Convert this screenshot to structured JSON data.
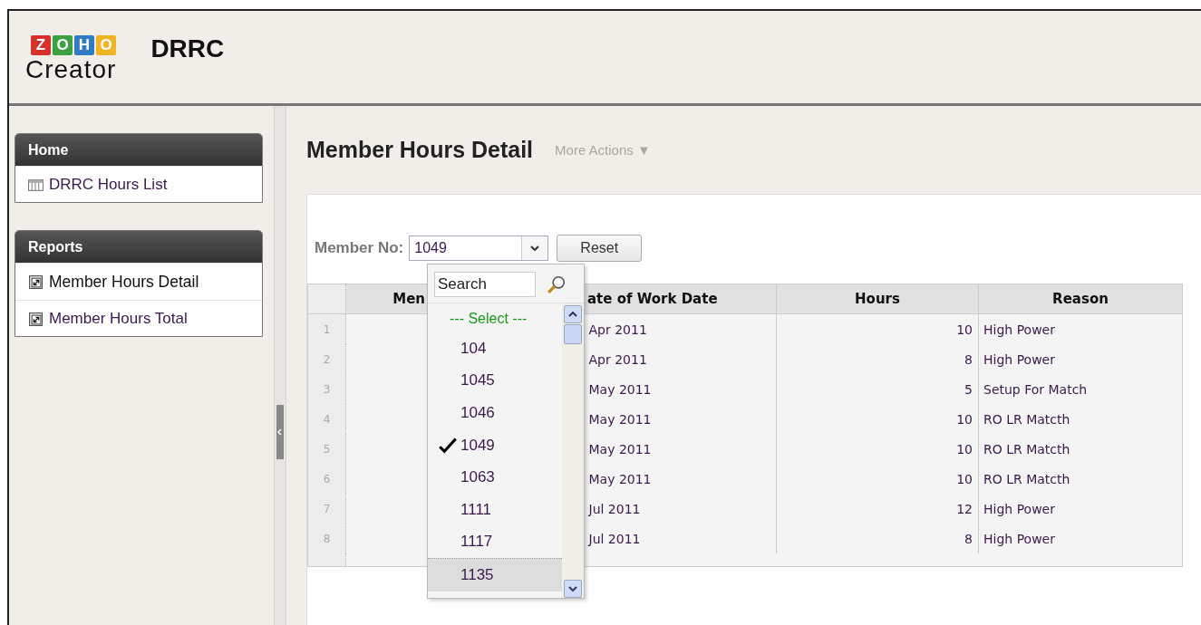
{
  "header": {
    "logo": {
      "letters": [
        {
          "char": "Z",
          "color": "#d8312b"
        },
        {
          "char": "O",
          "color": "#3aa040"
        },
        {
          "char": "H",
          "color": "#2f7bc4"
        },
        {
          "char": "O",
          "color": "#f0b323"
        }
      ],
      "product": "Creator"
    },
    "app_name": "DRRC"
  },
  "sidebar": {
    "sections": [
      {
        "title": "Home",
        "items": [
          {
            "label": "DRRC Hours List",
            "kind": "form",
            "selected": false
          }
        ]
      },
      {
        "title": "Reports",
        "items": [
          {
            "label": "Member Hours Detail",
            "kind": "report",
            "selected": true
          },
          {
            "label": "Member Hours Total",
            "kind": "report",
            "selected": false
          }
        ]
      }
    ]
  },
  "page": {
    "title": "Member Hours Detail",
    "more_actions": "More Actions ▼"
  },
  "filter": {
    "label": "Member No:",
    "value": "1049",
    "reset": "Reset"
  },
  "dropdown": {
    "search_placeholder": "Search",
    "options": [
      {
        "label": "--- Select ---",
        "kind": "prompt",
        "selected": false,
        "highlighted": false
      },
      {
        "label": "104",
        "kind": "value",
        "selected": false,
        "highlighted": false
      },
      {
        "label": "1045",
        "kind": "value",
        "selected": false,
        "highlighted": false
      },
      {
        "label": "1046",
        "kind": "value",
        "selected": false,
        "highlighted": false
      },
      {
        "label": "1049",
        "kind": "value",
        "selected": true,
        "highlighted": false
      },
      {
        "label": "1063",
        "kind": "value",
        "selected": false,
        "highlighted": false
      },
      {
        "label": "1111",
        "kind": "value",
        "selected": false,
        "highlighted": false
      },
      {
        "label": "1117",
        "kind": "value",
        "selected": false,
        "highlighted": false
      },
      {
        "label": "1135",
        "kind": "value",
        "selected": false,
        "highlighted": true
      }
    ]
  },
  "table": {
    "columns": [
      "Men",
      "ate of Work Date",
      "Hours",
      "Reason"
    ],
    "rows": [
      {
        "n": "1",
        "date": "Apr 2011",
        "hours": "10",
        "reason": "High Power"
      },
      {
        "n": "2",
        "date": "Apr 2011",
        "hours": "8",
        "reason": "High Power"
      },
      {
        "n": "3",
        "date": "May 2011",
        "hours": "5",
        "reason": "Setup For Match"
      },
      {
        "n": "4",
        "date": "May 2011",
        "hours": "10",
        "reason": "RO LR Matcth"
      },
      {
        "n": "5",
        "date": "May 2011",
        "hours": "10",
        "reason": "RO LR Matcth"
      },
      {
        "n": "6",
        "date": "May 2011",
        "hours": "10",
        "reason": "RO LR Matcth"
      },
      {
        "n": "7",
        "date": "Jul 2011",
        "hours": "12",
        "reason": "High Power"
      },
      {
        "n": "8",
        "date": "Jul 2011",
        "hours": "8",
        "reason": "High Power"
      }
    ]
  }
}
